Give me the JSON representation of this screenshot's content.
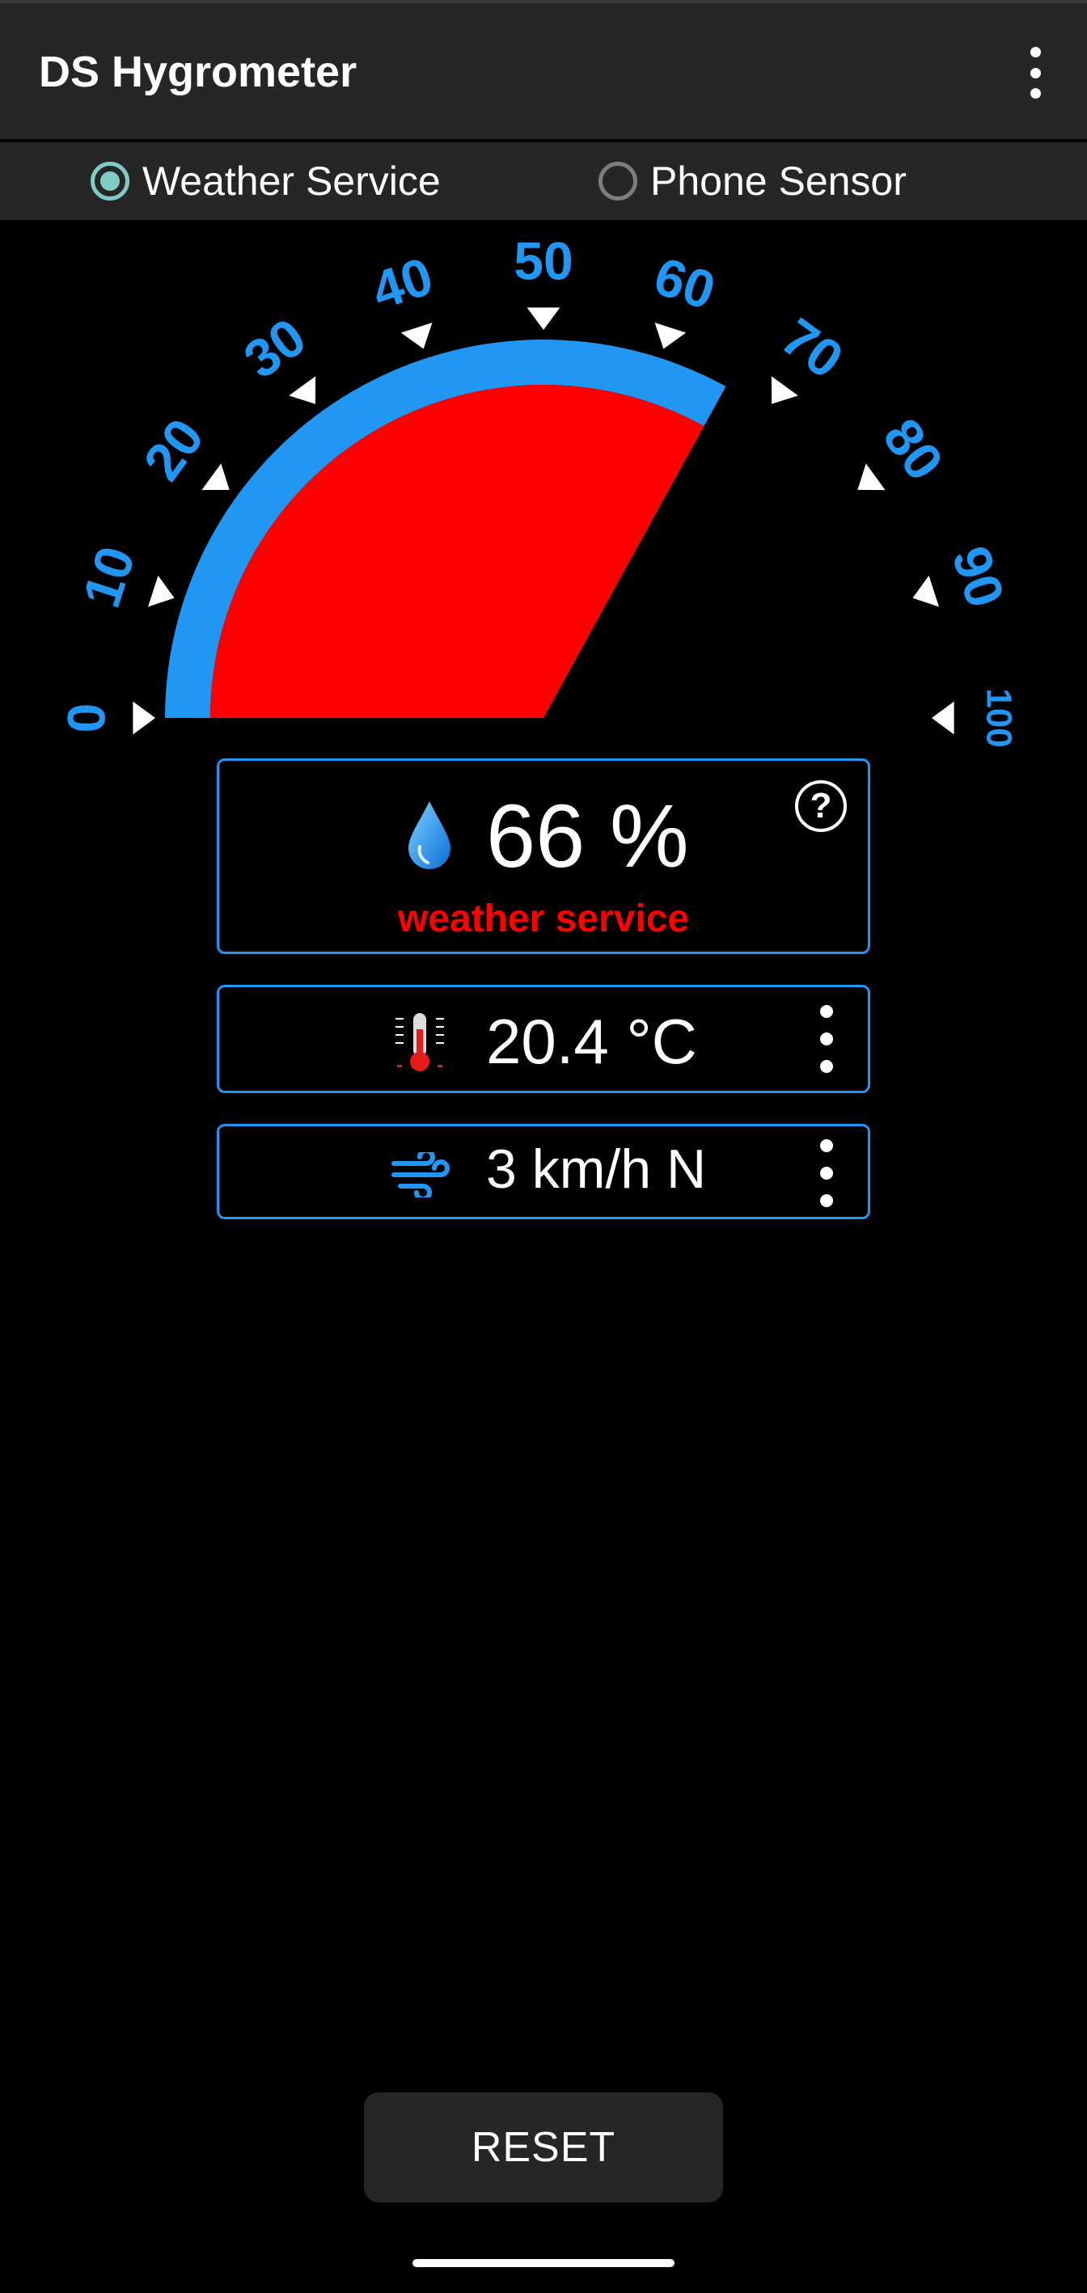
{
  "app": {
    "title": "DS Hygrometer",
    "menu_icon": "more-vert-icon"
  },
  "source_toggle": {
    "options": [
      {
        "label": "Weather Service",
        "selected": true
      },
      {
        "label": "Phone Sensor",
        "selected": false
      }
    ]
  },
  "gauge": {
    "tick_labels": [
      "0",
      "10",
      "20",
      "30",
      "40",
      "50",
      "60",
      "70",
      "80",
      "90",
      "100"
    ],
    "value": 66,
    "min": 0,
    "max": 100,
    "fill_color": "#ff0000",
    "arc_color": "#2196f3"
  },
  "humidity": {
    "value": "66 %",
    "source": "weather service",
    "icon": "water-drop-icon",
    "help_label": "?"
  },
  "temperature": {
    "value": "20.4 °C",
    "icon": "thermometer-icon"
  },
  "wind": {
    "value": "3 km/h N",
    "icon": "wind-icon"
  },
  "reset_label": "RESET",
  "colors": {
    "accent": "#2196f3",
    "radio": "#80cbc4",
    "alert": "#ff0000",
    "bar": "#262626"
  }
}
